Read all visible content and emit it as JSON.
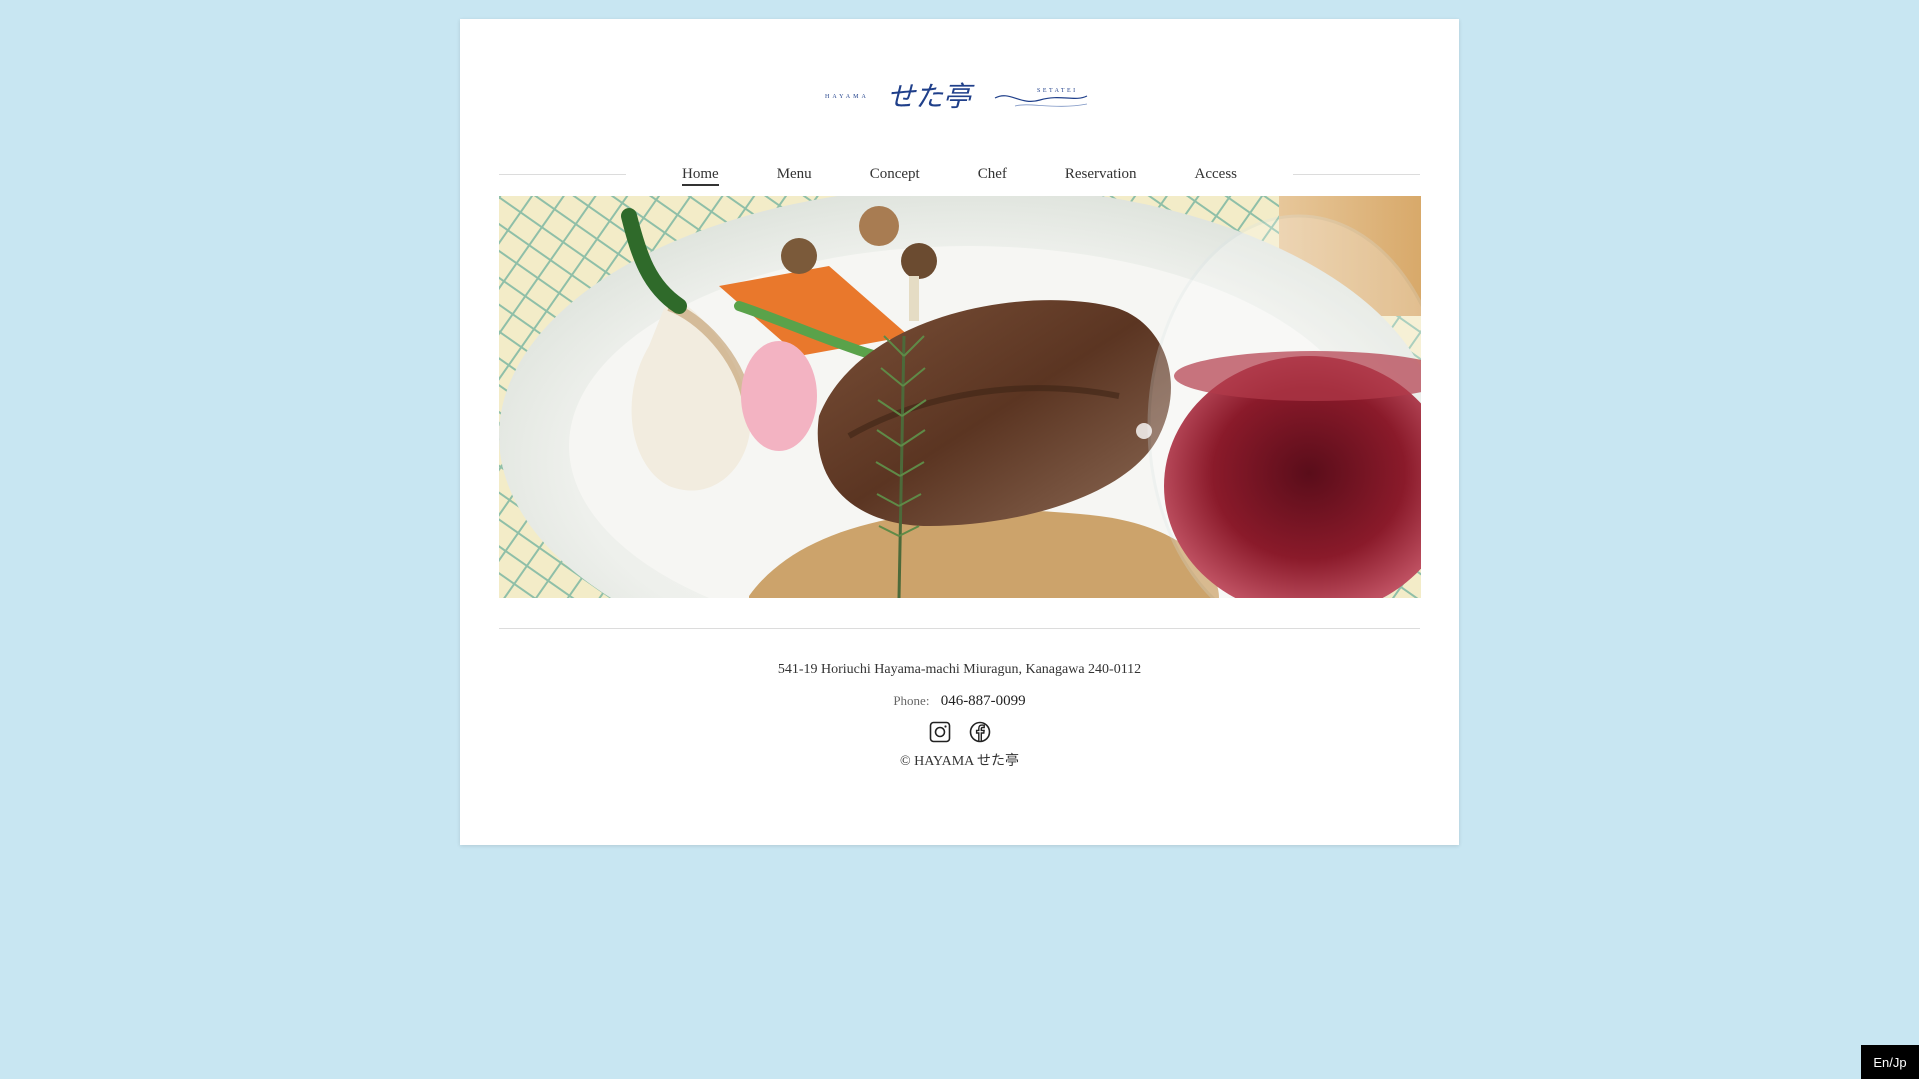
{
  "logo": {
    "left_text": "HAYAMA",
    "main_text": "せた亭",
    "right_text": "SETATEI",
    "brand_color": "#1f3f8a"
  },
  "nav": {
    "items": [
      {
        "label": "Home",
        "active": true
      },
      {
        "label": "Menu",
        "active": false
      },
      {
        "label": "Concept",
        "active": false
      },
      {
        "label": "Chef",
        "active": false
      },
      {
        "label": "Reservation",
        "active": false
      },
      {
        "label": "Access",
        "active": false
      }
    ]
  },
  "hero": {
    "alt": "Grilled lamb with roasted vegetables, rosemary and a glass of red wine"
  },
  "footer": {
    "address": "541-19 Horiuchi Hayama-machi Miuragun, Kanagawa 240-0112",
    "phone_label": "Phone:",
    "phone_number": "046-887-0099",
    "social": [
      {
        "icon": "instagram-icon"
      },
      {
        "icon": "facebook-icon"
      }
    ],
    "copyright": "© HAYAMA せた亭"
  },
  "lang_toggle": "En/Jp",
  "colors": {
    "background": "#c8e6f2",
    "card": "#ffffff",
    "text": "#333333"
  }
}
